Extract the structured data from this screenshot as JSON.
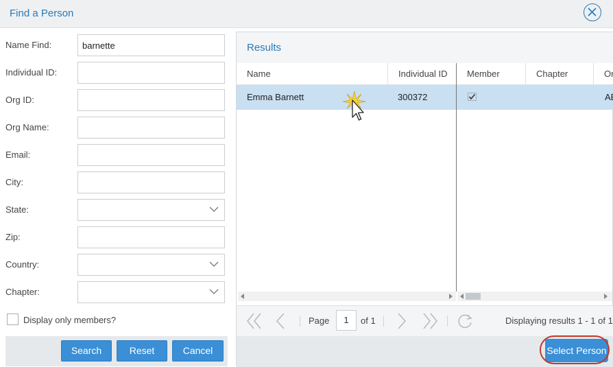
{
  "window": {
    "title": "Find a Person"
  },
  "form": {
    "name_find": {
      "label": "Name Find:",
      "value": "barnette"
    },
    "individual_id": {
      "label": "Individual ID:",
      "value": ""
    },
    "org_id": {
      "label": "Org ID:",
      "value": ""
    },
    "org_name": {
      "label": "Org Name:",
      "value": ""
    },
    "email": {
      "label": "Email:",
      "value": ""
    },
    "city": {
      "label": "City:",
      "value": ""
    },
    "state": {
      "label": "State:",
      "value": ""
    },
    "zip": {
      "label": "Zip:",
      "value": ""
    },
    "country": {
      "label": "Country:",
      "value": ""
    },
    "chapter": {
      "label": "Chapter:",
      "value": ""
    },
    "members_only": {
      "label": "Display only members?",
      "checked": false
    }
  },
  "buttons": {
    "search": "Search",
    "reset": "Reset",
    "cancel": "Cancel",
    "select_person": "Select Person"
  },
  "results": {
    "title": "Results",
    "columns": [
      "Name",
      "Individual ID",
      "Member",
      "Chapter",
      "Or"
    ],
    "rows": [
      {
        "name": "Emma Barnett",
        "individual_id": "300372",
        "member": true,
        "chapter": "",
        "org": "AE"
      }
    ],
    "selected_row": 0
  },
  "pager": {
    "page_label": "Page",
    "page": "1",
    "of_label": "of 1",
    "summary": "Displaying results 1 - 1 of 1"
  },
  "colors": {
    "accent": "#2a7ab8",
    "button": "#3a8fd6",
    "selected_row": "#c9dff2",
    "highlight_ring": "#c0392b"
  }
}
